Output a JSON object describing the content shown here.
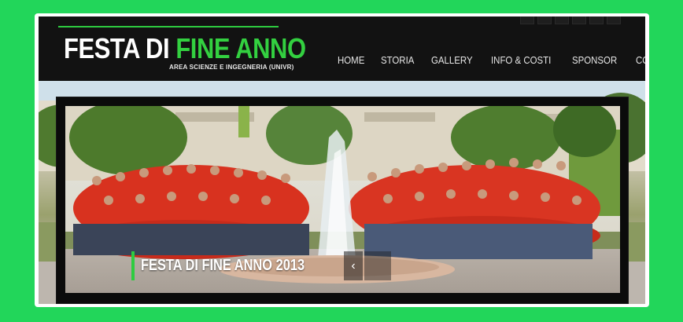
{
  "logo": {
    "title_white": "FESTA DI ",
    "title_green": "FINE ANNO",
    "subtitle": "AREA SCIENZE E INGEGNERIA (UNIVR)"
  },
  "nav": {
    "items": [
      "HOME",
      "STORIA",
      "GALLERY",
      "INFO & COSTI",
      "SPONSOR",
      "CONTATTI"
    ]
  },
  "social": {
    "icons": [
      "social-icon",
      "social-icon",
      "social-icon",
      "social-icon",
      "social-icon",
      "social-icon"
    ]
  },
  "slider": {
    "caption": "FESTA DI FINE ANNO 2013",
    "prev_symbol": "‹",
    "next_symbol": ""
  },
  "colors": {
    "page_background": "#22d65a",
    "accent_green": "#2ecc40",
    "header_background": "#121212"
  }
}
